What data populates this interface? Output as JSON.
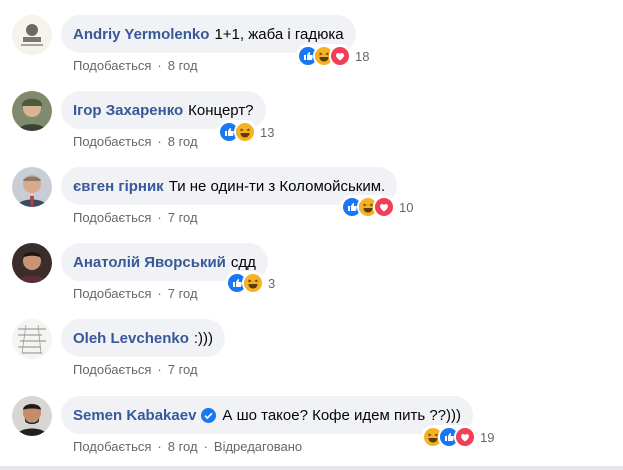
{
  "comments": [
    {
      "author": "Andriy Yermolenko",
      "text": "1+1, жаба і гадюка",
      "like_label": "Подобається",
      "dot": "·",
      "time": "8 год",
      "reaction_count": "18",
      "reactions": [
        "like-icon",
        "haha-icon",
        "love-icon"
      ]
    },
    {
      "author": "Ігор Захаренко",
      "text": "Концерт?",
      "like_label": "Подобається",
      "dot": "·",
      "time": "8 год",
      "reaction_count": "13",
      "reactions": [
        "like-icon",
        "haha-icon"
      ]
    },
    {
      "author": "євген гірник",
      "text": "Ти не один-ти з Коломойським.",
      "like_label": "Подобається",
      "dot": "·",
      "time": "7 год",
      "reaction_count": "10",
      "reactions": [
        "like-icon",
        "haha-icon",
        "love-icon"
      ]
    },
    {
      "author": "Анатолій Яворський",
      "text": "сдд",
      "like_label": "Подобається",
      "dot": "·",
      "time": "7 год",
      "reaction_count": "3",
      "reactions": [
        "like-icon",
        "haha-icon"
      ]
    },
    {
      "author": "Oleh Levchenko",
      "text": ":)))",
      "like_label": "Подобається",
      "dot": "·",
      "time": "7 год"
    },
    {
      "author": "Semen Kabakaev",
      "text": "А шо такое? Кофе идем пить ??)))",
      "like_label": "Подобається",
      "dot": "·",
      "time": "8 год",
      "edited_label": "Відредаговано",
      "reaction_count": "19",
      "reactions": [
        "haha-icon",
        "like-icon",
        "love-icon"
      ],
      "verified": "verified-badge-icon"
    }
  ],
  "colors": {
    "author": "#385898",
    "bubble": "#f0f2f5",
    "meta": "#65676b",
    "like": "#1877f2",
    "haha": "#f7b125",
    "love": "#f33e58"
  }
}
